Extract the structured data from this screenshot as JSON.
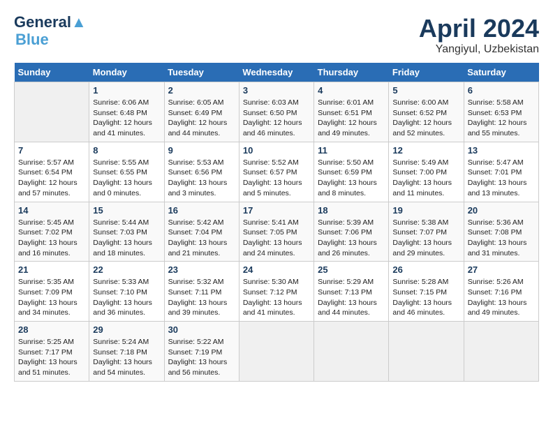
{
  "header": {
    "logo_line1": "General",
    "logo_line2": "Blue",
    "month_title": "April 2024",
    "location": "Yangiyul, Uzbekistan"
  },
  "weekdays": [
    "Sunday",
    "Monday",
    "Tuesday",
    "Wednesday",
    "Thursday",
    "Friday",
    "Saturday"
  ],
  "weeks": [
    [
      {
        "day": "",
        "info": ""
      },
      {
        "day": "1",
        "info": "Sunrise: 6:06 AM\nSunset: 6:48 PM\nDaylight: 12 hours\nand 41 minutes."
      },
      {
        "day": "2",
        "info": "Sunrise: 6:05 AM\nSunset: 6:49 PM\nDaylight: 12 hours\nand 44 minutes."
      },
      {
        "day": "3",
        "info": "Sunrise: 6:03 AM\nSunset: 6:50 PM\nDaylight: 12 hours\nand 46 minutes."
      },
      {
        "day": "4",
        "info": "Sunrise: 6:01 AM\nSunset: 6:51 PM\nDaylight: 12 hours\nand 49 minutes."
      },
      {
        "day": "5",
        "info": "Sunrise: 6:00 AM\nSunset: 6:52 PM\nDaylight: 12 hours\nand 52 minutes."
      },
      {
        "day": "6",
        "info": "Sunrise: 5:58 AM\nSunset: 6:53 PM\nDaylight: 12 hours\nand 55 minutes."
      }
    ],
    [
      {
        "day": "7",
        "info": "Sunrise: 5:57 AM\nSunset: 6:54 PM\nDaylight: 12 hours\nand 57 minutes."
      },
      {
        "day": "8",
        "info": "Sunrise: 5:55 AM\nSunset: 6:55 PM\nDaylight: 13 hours\nand 0 minutes."
      },
      {
        "day": "9",
        "info": "Sunrise: 5:53 AM\nSunset: 6:56 PM\nDaylight: 13 hours\nand 3 minutes."
      },
      {
        "day": "10",
        "info": "Sunrise: 5:52 AM\nSunset: 6:57 PM\nDaylight: 13 hours\nand 5 minutes."
      },
      {
        "day": "11",
        "info": "Sunrise: 5:50 AM\nSunset: 6:59 PM\nDaylight: 13 hours\nand 8 minutes."
      },
      {
        "day": "12",
        "info": "Sunrise: 5:49 AM\nSunset: 7:00 PM\nDaylight: 13 hours\nand 11 minutes."
      },
      {
        "day": "13",
        "info": "Sunrise: 5:47 AM\nSunset: 7:01 PM\nDaylight: 13 hours\nand 13 minutes."
      }
    ],
    [
      {
        "day": "14",
        "info": "Sunrise: 5:45 AM\nSunset: 7:02 PM\nDaylight: 13 hours\nand 16 minutes."
      },
      {
        "day": "15",
        "info": "Sunrise: 5:44 AM\nSunset: 7:03 PM\nDaylight: 13 hours\nand 18 minutes."
      },
      {
        "day": "16",
        "info": "Sunrise: 5:42 AM\nSunset: 7:04 PM\nDaylight: 13 hours\nand 21 minutes."
      },
      {
        "day": "17",
        "info": "Sunrise: 5:41 AM\nSunset: 7:05 PM\nDaylight: 13 hours\nand 24 minutes."
      },
      {
        "day": "18",
        "info": "Sunrise: 5:39 AM\nSunset: 7:06 PM\nDaylight: 13 hours\nand 26 minutes."
      },
      {
        "day": "19",
        "info": "Sunrise: 5:38 AM\nSunset: 7:07 PM\nDaylight: 13 hours\nand 29 minutes."
      },
      {
        "day": "20",
        "info": "Sunrise: 5:36 AM\nSunset: 7:08 PM\nDaylight: 13 hours\nand 31 minutes."
      }
    ],
    [
      {
        "day": "21",
        "info": "Sunrise: 5:35 AM\nSunset: 7:09 PM\nDaylight: 13 hours\nand 34 minutes."
      },
      {
        "day": "22",
        "info": "Sunrise: 5:33 AM\nSunset: 7:10 PM\nDaylight: 13 hours\nand 36 minutes."
      },
      {
        "day": "23",
        "info": "Sunrise: 5:32 AM\nSunset: 7:11 PM\nDaylight: 13 hours\nand 39 minutes."
      },
      {
        "day": "24",
        "info": "Sunrise: 5:30 AM\nSunset: 7:12 PM\nDaylight: 13 hours\nand 41 minutes."
      },
      {
        "day": "25",
        "info": "Sunrise: 5:29 AM\nSunset: 7:13 PM\nDaylight: 13 hours\nand 44 minutes."
      },
      {
        "day": "26",
        "info": "Sunrise: 5:28 AM\nSunset: 7:15 PM\nDaylight: 13 hours\nand 46 minutes."
      },
      {
        "day": "27",
        "info": "Sunrise: 5:26 AM\nSunset: 7:16 PM\nDaylight: 13 hours\nand 49 minutes."
      }
    ],
    [
      {
        "day": "28",
        "info": "Sunrise: 5:25 AM\nSunset: 7:17 PM\nDaylight: 13 hours\nand 51 minutes."
      },
      {
        "day": "29",
        "info": "Sunrise: 5:24 AM\nSunset: 7:18 PM\nDaylight: 13 hours\nand 54 minutes."
      },
      {
        "day": "30",
        "info": "Sunrise: 5:22 AM\nSunset: 7:19 PM\nDaylight: 13 hours\nand 56 minutes."
      },
      {
        "day": "",
        "info": ""
      },
      {
        "day": "",
        "info": ""
      },
      {
        "day": "",
        "info": ""
      },
      {
        "day": "",
        "info": ""
      }
    ]
  ]
}
